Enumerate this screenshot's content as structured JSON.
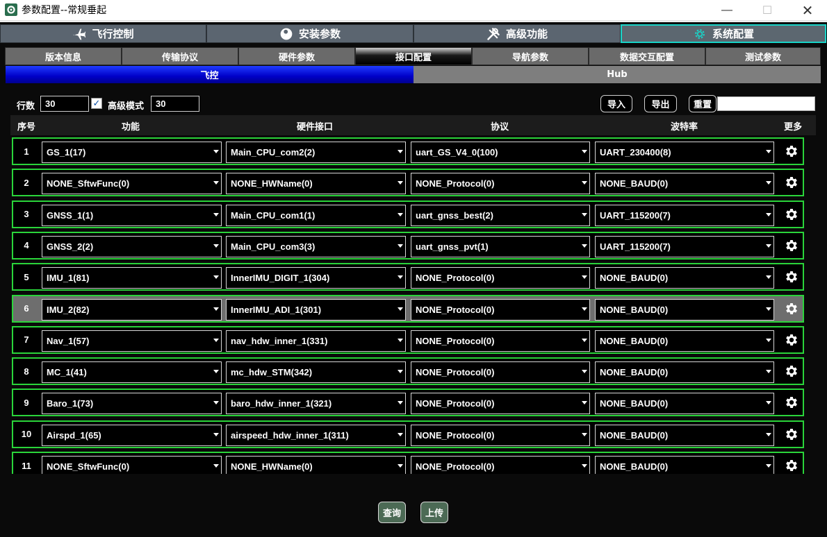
{
  "window": {
    "title": "参数配置--常规垂起",
    "min_glyph": "—",
    "max_glyph": "☐",
    "close_glyph": "✕"
  },
  "top_tabs": [
    {
      "label": "飞行控制",
      "icon": "plane-icon",
      "active": false
    },
    {
      "label": "安装参数",
      "icon": "wrench-circle-icon",
      "active": false
    },
    {
      "label": "高级功能",
      "icon": "tools-icon",
      "active": false
    },
    {
      "label": "系统配置",
      "icon": "gear-icon",
      "active": true
    }
  ],
  "sub_tabs": [
    {
      "label": "版本信息",
      "active": false
    },
    {
      "label": "传输协议",
      "active": false
    },
    {
      "label": "硬件参数",
      "active": false
    },
    {
      "label": "接口配置",
      "active": true
    },
    {
      "label": "导航参数",
      "active": false
    },
    {
      "label": "数据交互配置",
      "active": false
    },
    {
      "label": "测试参数",
      "active": false
    }
  ],
  "segments": {
    "fc": "飞控",
    "hub": "Hub"
  },
  "controls": {
    "rows_label": "行数",
    "rows_value": "30",
    "advanced_label": "高级模式",
    "advanced_checked": "✓",
    "advanced_value": "30",
    "import_label": "导入",
    "export_label": "导出",
    "reset_label": "重置",
    "search_value": ""
  },
  "table": {
    "headers": {
      "index": "序号",
      "function": "功能",
      "hw": "硬件接口",
      "protocol": "协议",
      "baud": "波特率",
      "more": "更多"
    },
    "rows": [
      {
        "n": "1",
        "func": "GS_1(17)",
        "hw": "Main_CPU_com2(2)",
        "proto": "uart_GS_V4_0(100)",
        "baud": "UART_230400(8)"
      },
      {
        "n": "2",
        "func": "NONE_SftwFunc(0)",
        "hw": "NONE_HWName(0)",
        "proto": "NONE_Protocol(0)",
        "baud": "NONE_BAUD(0)"
      },
      {
        "n": "3",
        "func": "GNSS_1(1)",
        "hw": "Main_CPU_com1(1)",
        "proto": "uart_gnss_best(2)",
        "baud": "UART_115200(7)"
      },
      {
        "n": "4",
        "func": "GNSS_2(2)",
        "hw": "Main_CPU_com3(3)",
        "proto": "uart_gnss_pvt(1)",
        "baud": "UART_115200(7)"
      },
      {
        "n": "5",
        "func": "IMU_1(81)",
        "hw": "InnerIMU_DIGIT_1(304)",
        "proto": "NONE_Protocol(0)",
        "baud": "NONE_BAUD(0)"
      },
      {
        "n": "6",
        "func": "IMU_2(82)",
        "hw": "InnerIMU_ADI_1(301)",
        "proto": "NONE_Protocol(0)",
        "baud": "NONE_BAUD(0)",
        "selected": true
      },
      {
        "n": "7",
        "func": "Nav_1(57)",
        "hw": "nav_hdw_inner_1(331)",
        "proto": "NONE_Protocol(0)",
        "baud": "NONE_BAUD(0)"
      },
      {
        "n": "8",
        "func": "MC_1(41)",
        "hw": "mc_hdw_STM(342)",
        "proto": "NONE_Protocol(0)",
        "baud": "NONE_BAUD(0)"
      },
      {
        "n": "9",
        "func": "Baro_1(73)",
        "hw": "baro_hdw_inner_1(321)",
        "proto": "NONE_Protocol(0)",
        "baud": "NONE_BAUD(0)"
      },
      {
        "n": "10",
        "func": "Airspd_1(65)",
        "hw": "airspeed_hdw_inner_1(311)",
        "proto": "NONE_Protocol(0)",
        "baud": "NONE_BAUD(0)"
      },
      {
        "n": "11",
        "func": "NONE_SftwFunc(0)",
        "hw": "NONE_HWName(0)",
        "proto": "NONE_Protocol(0)",
        "baud": "NONE_BAUD(0)"
      }
    ]
  },
  "bottom": {
    "query_label": "查询",
    "upload_label": "上传"
  },
  "colors": {
    "accent": "#19d4c8",
    "row_border": "#2ad43a",
    "fc_tab": "#0000c8",
    "selected_row": "#6e6e6e"
  }
}
